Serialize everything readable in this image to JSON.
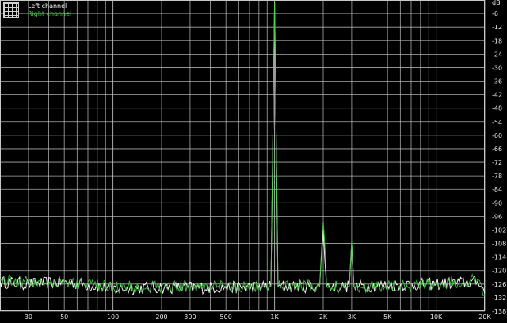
{
  "legend": {
    "left_label": "Left channel",
    "right_label": "Right channel"
  },
  "colors": {
    "background": "#000000",
    "grid": "#c8c8c8",
    "left_channel": "#ffffff",
    "right_channel": "#3cc83c",
    "tick_text": "#e6e6e6"
  },
  "chart_data": {
    "type": "line",
    "title": "",
    "xlabel": "",
    "ylabel": "dB",
    "x_scale": "log",
    "xlim": [
      20,
      20000
    ],
    "ylim": [
      -138,
      0
    ],
    "y_ticks": [
      "dB",
      "-6",
      "-12",
      "-18",
      "-24",
      "-30",
      "-36",
      "-42",
      "-48",
      "-54",
      "-60",
      "-66",
      "-72",
      "-78",
      "-84",
      "-90",
      "-96",
      "-102",
      "-108",
      "-114",
      "-120",
      "-126",
      "-132",
      "-138"
    ],
    "x_ticks": [
      {
        "value": 30,
        "label": "30"
      },
      {
        "value": 50,
        "label": "50"
      },
      {
        "value": 100,
        "label": "100"
      },
      {
        "value": 200,
        "label": "200"
      },
      {
        "value": 300,
        "label": "300"
      },
      {
        "value": 500,
        "label": "500"
      },
      {
        "value": 1000,
        "label": "1K"
      },
      {
        "value": 2000,
        "label": "2K"
      },
      {
        "value": 3000,
        "label": "3K"
      },
      {
        "value": 5000,
        "label": "5K"
      },
      {
        "value": 10000,
        "label": "10K"
      },
      {
        "value": 20000,
        "label": "20K"
      }
    ],
    "grid": true,
    "legend_position": "top-left",
    "series": [
      {
        "name": "Left channel",
        "x": [
          20,
          30,
          50,
          100,
          200,
          500,
          950,
          1000,
          1050,
          1900,
          2000,
          2100,
          2900,
          3000,
          3100,
          5000,
          10000,
          18000,
          19000,
          20000
        ],
        "y": [
          -125,
          -126,
          -125,
          -128,
          -127.5,
          -127.5,
          -127,
          -1,
          -127,
          -127,
          -102,
          -127,
          -127,
          -108,
          -127,
          -126.5,
          -126,
          -125,
          -127,
          -130
        ]
      },
      {
        "name": "Right channel",
        "x": [
          20,
          30,
          50,
          100,
          200,
          500,
          950,
          1000,
          1050,
          1900,
          2000,
          2100,
          2900,
          3000,
          3100,
          5000,
          10000,
          18000,
          19000,
          20000
        ],
        "y": [
          -124,
          -125,
          -125,
          -127.5,
          -127,
          -127,
          -127,
          -1,
          -127,
          -127,
          -98,
          -127,
          -127,
          -107,
          -127,
          -126.5,
          -126,
          -124,
          -126,
          -131
        ]
      }
    ]
  }
}
